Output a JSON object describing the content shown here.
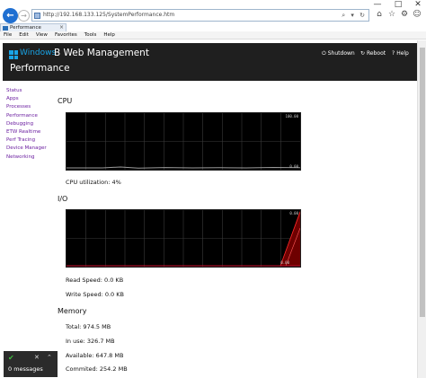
{
  "browser": {
    "window_controls": [
      "—",
      "□",
      "✕"
    ],
    "url": "http://192.168.133.125/SystemPerformance.htm",
    "addr_tools": "⌕ ▾ ↻",
    "tab_title": "Performance",
    "tab_close": "×",
    "menu": [
      "File",
      "Edit",
      "View",
      "Favorites",
      "Tools",
      "Help"
    ],
    "icons": [
      "home-icon",
      "star-icon",
      "gear-icon",
      "smiley-icon"
    ]
  },
  "header": {
    "brand_windows": "Windows",
    "brand_rest": "B Web Management",
    "page_title": "Performance",
    "actions": {
      "shutdown": "Shutdown",
      "reboot": "Reboot",
      "help": "Help"
    },
    "colors": {
      "bar": "#1f1f1f",
      "brand": "#19a4e6"
    }
  },
  "sidebar": {
    "items": [
      "Status",
      "Apps",
      "Processes",
      "Performance",
      "Debugging",
      "ETW Realtime",
      "Perf Tracing",
      "Device Manager",
      "Networking"
    ],
    "link_color": "#6b1fa0"
  },
  "cpu": {
    "title": "CPU",
    "scale_max": "100.00",
    "scale_min": "0.00",
    "utilization_label": "CPU utilization: 4%",
    "utilization_percent": 4
  },
  "io": {
    "title": "I/O",
    "scale_max": "0.00",
    "scale_min": "0.00",
    "read_speed": "Read Speed: 0.0 KB",
    "write_speed": "Write Speed: 0.0 KB"
  },
  "memory": {
    "title": "Memory",
    "total": "Total: 974.5 MB",
    "in_use": "In use: 326.7 MB",
    "available": "Available: 647.8 MB",
    "committed": "Commited: 254.2 MB"
  },
  "notification": {
    "text": "0 messages"
  }
}
